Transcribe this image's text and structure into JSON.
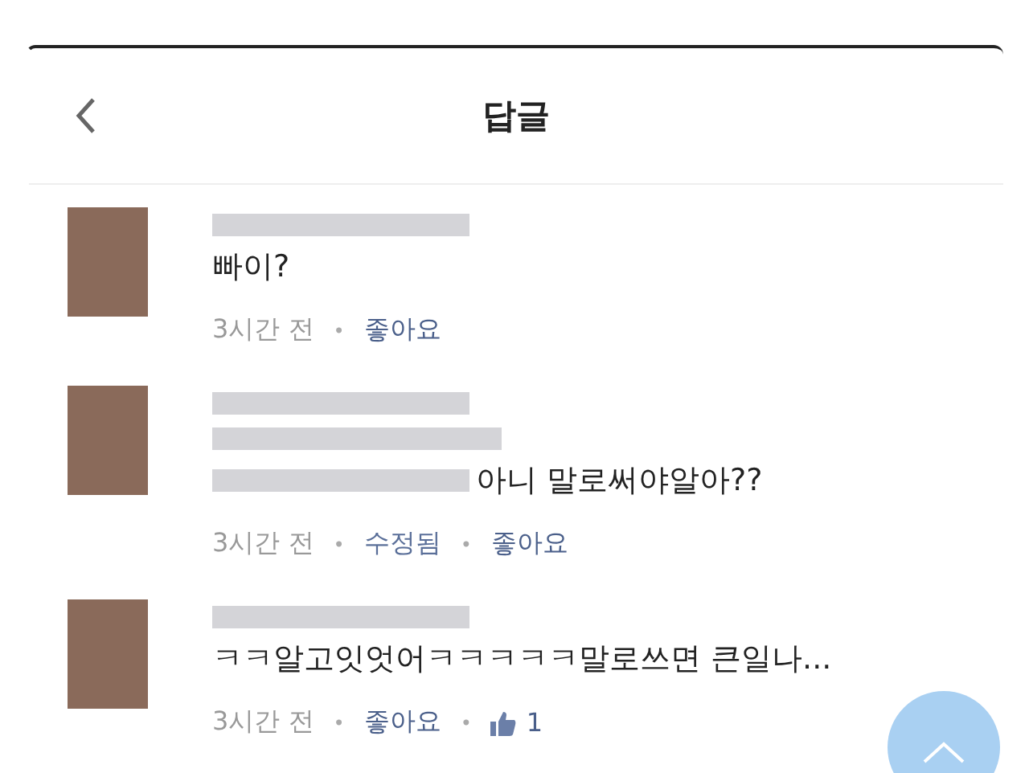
{
  "header": {
    "title": "답글"
  },
  "comments": [
    {
      "long_name": false,
      "mention": false,
      "text": "빠이?",
      "meta": [
        {
          "kind": "time",
          "text": "3시간 전"
        },
        {
          "kind": "action",
          "separator": "•",
          "text": "좋아요"
        }
      ]
    },
    {
      "long_name": true,
      "mention": true,
      "text": "아니 말로써야알아??",
      "meta": [
        {
          "kind": "time",
          "text": "3시간 전"
        },
        {
          "kind": "status",
          "separator": "•",
          "text": "수정됨"
        },
        {
          "kind": "action",
          "separator": "•",
          "text": "좋아요"
        }
      ]
    },
    {
      "long_name": false,
      "mention": false,
      "text": "ㅋㅋ알고잇엇어ㅋㅋㅋㅋㅋ말로쓰면 큰일나...",
      "meta": [
        {
          "kind": "time",
          "text": "3시간 전"
        },
        {
          "kind": "action",
          "separator": "•",
          "text": "좋아요"
        },
        {
          "kind": "likes",
          "separator": "•",
          "text": "1"
        }
      ]
    }
  ]
}
